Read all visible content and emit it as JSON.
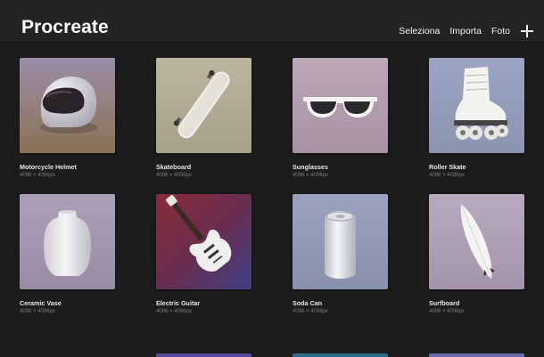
{
  "header": {
    "title": "Procreate",
    "nav": [
      "Seleziona",
      "Importa",
      "Foto"
    ]
  },
  "gallery": {
    "items": [
      {
        "title": "Motorcycle Helmet",
        "size": "4096 × 4096px",
        "icon": "helmet-artwork",
        "bg_top": "#9b8da8",
        "bg_bottom": "#8a7254"
      },
      {
        "title": "Skateboard",
        "size": "4096 × 4096px",
        "icon": "skateboard-artwork",
        "bg_top": "#b9b29c",
        "bg_bottom": "#a9a28a"
      },
      {
        "title": "Sunglasses",
        "size": "4096 × 4096px",
        "icon": "sunglasses-artwork",
        "bg_top": "#bba7b6",
        "bg_bottom": "#a792a5"
      },
      {
        "title": "Roller Skate",
        "size": "4096 × 4096px",
        "icon": "roller-skate-artwork",
        "bg_top": "#9aa3c2",
        "bg_bottom": "#8c95b0"
      },
      {
        "title": "Ceramic Vase",
        "size": "4096 × 4096px",
        "icon": "vase-artwork",
        "bg_top": "#ab9fb8",
        "bg_bottom": "#9a8ea6"
      },
      {
        "title": "Electric Guitar",
        "size": "4096 × 4096px",
        "icon": "guitar-artwork",
        "bg_top": "#7d2c3c",
        "bg_bottom": "#463a7a"
      },
      {
        "title": "Soda Can",
        "size": "4096 × 4096px",
        "icon": "soda-can-artwork",
        "bg_top": "#9aa1bf",
        "bg_bottom": "#8a91ad"
      },
      {
        "title": "Surfboard",
        "size": "4096 × 4096px",
        "icon": "surfboard-artwork",
        "bg_top": "#b6a9bd",
        "bg_bottom": "#a596ab"
      }
    ],
    "partial_colors": [
      "#5a4a9a",
      "#2f6a8a",
      "#6a6aa8"
    ]
  }
}
